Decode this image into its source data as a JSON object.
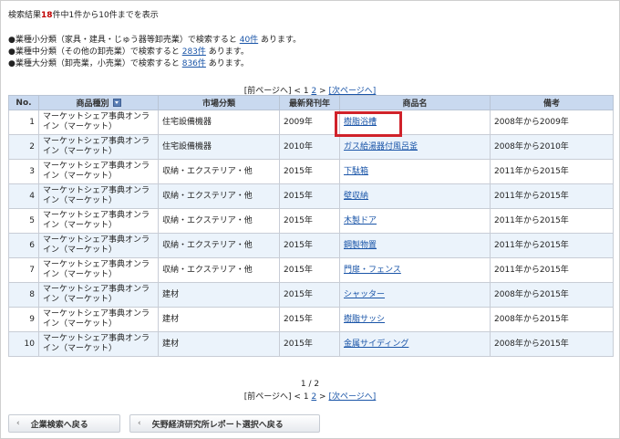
{
  "summary": {
    "prefix": "検索結果",
    "count": "18",
    "rest": "件中1件から10件までを表示"
  },
  "categories": [
    {
      "text": "●業種小分類（家具・建具・じゅう器等卸売業）で検索すると ",
      "link": "40件",
      "suffix": " あります。"
    },
    {
      "text": "●業種中分類（その他の卸売業）で検索すると ",
      "link": "283件",
      "suffix": " あります。"
    },
    {
      "text": "●業種大分類（卸売業，小売業）で検索すると ",
      "link": "836件",
      "suffix": " あります。"
    }
  ],
  "pager": {
    "prev": "[前ページへ]",
    "lt": "<",
    "page1": "1",
    "page2": "2",
    "gt": ">",
    "next": "[次ページへ]",
    "page_status": "1 / 2"
  },
  "table": {
    "headers": {
      "no": "No.",
      "type": "商品種別",
      "market": "市場分類",
      "year": "最新発刊年",
      "name": "商品名",
      "note": "備考"
    },
    "rows": [
      {
        "no": "1",
        "type": "マーケットシェア事典オンライン（マーケット）",
        "market": "住宅設備機器",
        "year": "2009年",
        "name": "樹脂浴槽",
        "note": "2008年から2009年"
      },
      {
        "no": "2",
        "type": "マーケットシェア事典オンライン（マーケット）",
        "market": "住宅設備機器",
        "year": "2010年",
        "name": "ガス給湯器付風呂釜",
        "note": "2008年から2010年"
      },
      {
        "no": "3",
        "type": "マーケットシェア事典オンライン（マーケット）",
        "market": "収納・エクステリア・他",
        "year": "2015年",
        "name": "下駄箱",
        "note": "2011年から2015年"
      },
      {
        "no": "4",
        "type": "マーケットシェア事典オンライン（マーケット）",
        "market": "収納・エクステリア・他",
        "year": "2015年",
        "name": "壁収納",
        "note": "2011年から2015年"
      },
      {
        "no": "5",
        "type": "マーケットシェア事典オンライン（マーケット）",
        "market": "収納・エクステリア・他",
        "year": "2015年",
        "name": "木製ドア",
        "note": "2011年から2015年"
      },
      {
        "no": "6",
        "type": "マーケットシェア事典オンライン（マーケット）",
        "market": "収納・エクステリア・他",
        "year": "2015年",
        "name": "鋼製物置",
        "note": "2011年から2015年"
      },
      {
        "no": "7",
        "type": "マーケットシェア事典オンライン（マーケット）",
        "market": "収納・エクステリア・他",
        "year": "2015年",
        "name": "門扉・フェンス",
        "note": "2011年から2015年"
      },
      {
        "no": "8",
        "type": "マーケットシェア事典オンライン（マーケット）",
        "market": "建材",
        "year": "2015年",
        "name": "シャッター",
        "note": "2008年から2015年"
      },
      {
        "no": "9",
        "type": "マーケットシェア事典オンライン（マーケット）",
        "market": "建材",
        "year": "2015年",
        "name": "樹脂サッシ",
        "note": "2008年から2015年"
      },
      {
        "no": "10",
        "type": "マーケットシェア事典オンライン（マーケット）",
        "market": "建材",
        "year": "2015年",
        "name": "金属サイディング",
        "note": "2008年から2015年"
      }
    ]
  },
  "buttons": {
    "back_company": "企業検索へ戻る",
    "back_report": "矢野経済研究所レポート選択へ戻る",
    "chevron": "‹"
  },
  "icons": {
    "sort": "sort-icon"
  },
  "colors": {
    "header_bg": "#c9d9ef",
    "row_alt": "#ebf3fb",
    "link": "#1a55a8",
    "highlight": "#d0222a",
    "count": "#c00000"
  }
}
